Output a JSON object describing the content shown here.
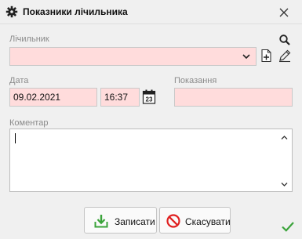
{
  "window": {
    "title": "Показники лічильника",
    "title_icon": "gear-icon",
    "close_icon": "close-icon"
  },
  "meter": {
    "label": "Лічильник",
    "value": "",
    "icons": [
      "chevron-down-icon",
      "search-icon",
      "add-document-icon",
      "edit-pencil-icon"
    ]
  },
  "date": {
    "label": "Дата",
    "value": "09.02.2021",
    "time_value": "16:37",
    "calendar_day": "23",
    "calendar_icon": "calendar-icon"
  },
  "reading": {
    "label": "Показання",
    "value": ""
  },
  "comment": {
    "label": "Коментар",
    "value": ""
  },
  "buttons": {
    "save": "Записати",
    "save_icon": "save-download-icon",
    "cancel": "Скасувати",
    "cancel_icon": "cancel-icon",
    "ok_icon": "checkmark-icon"
  },
  "colors": {
    "required_field": "#ffdcdc",
    "save_icon": "#3aa33a",
    "cancel_icon": "#e02020",
    "checkmark": "#3aa33a"
  }
}
